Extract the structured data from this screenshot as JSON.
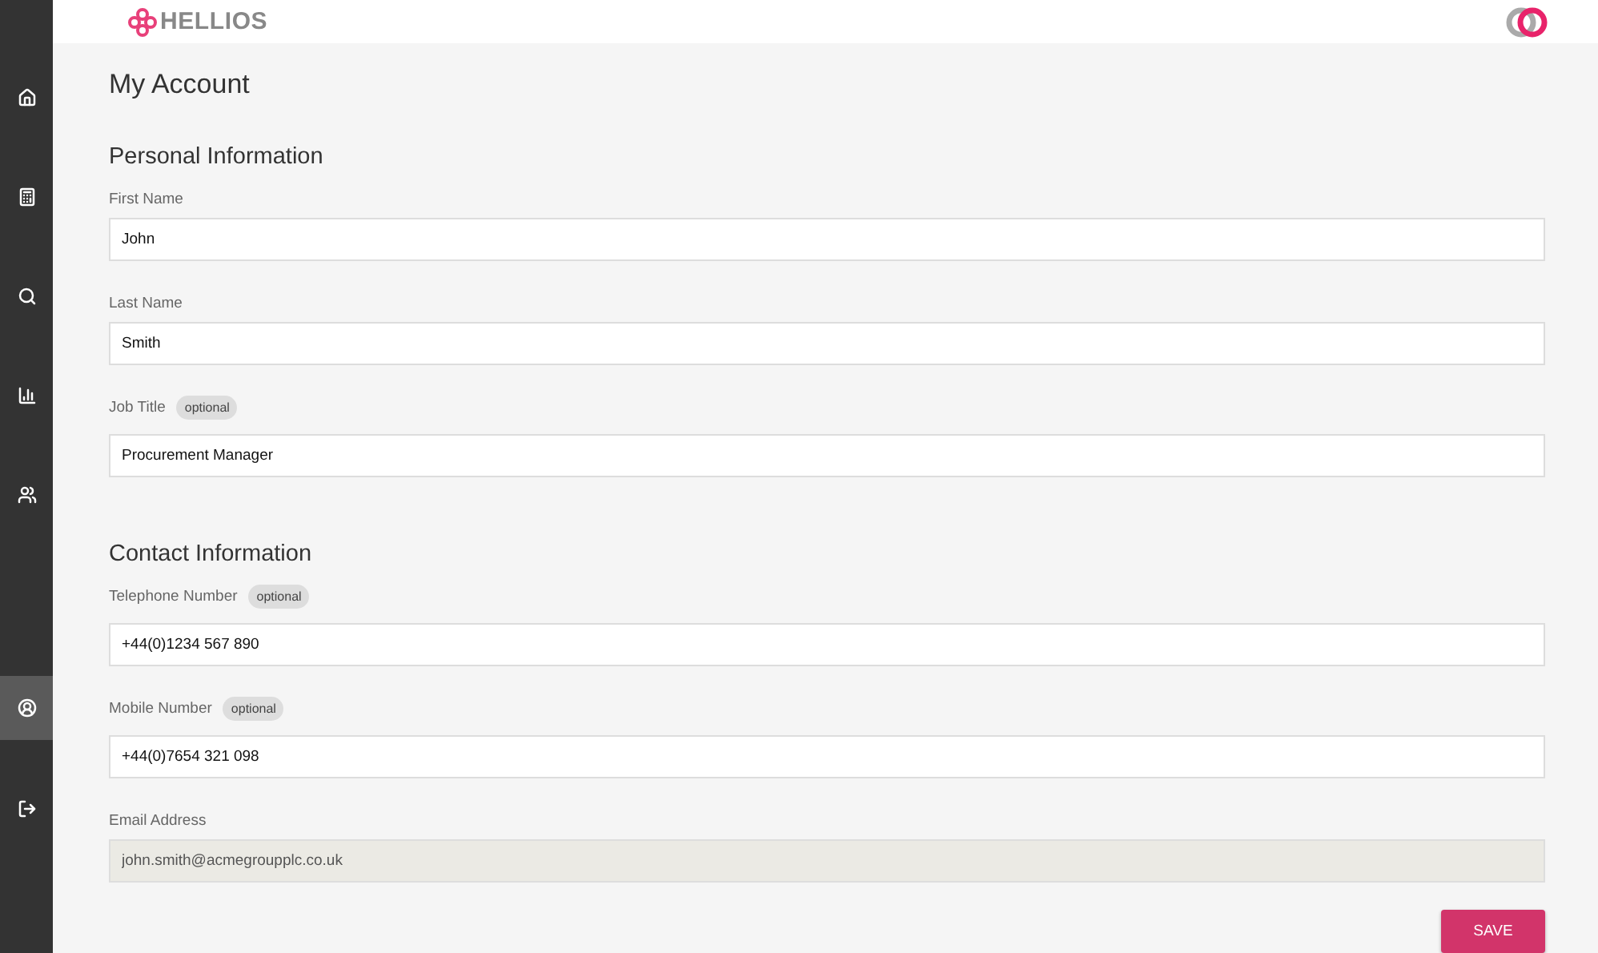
{
  "header": {
    "logo_text": "HELLIOS"
  },
  "sidebar": {
    "items": [
      {
        "kind": "home",
        "selected": false
      },
      {
        "kind": "calculator",
        "selected": false
      },
      {
        "kind": "search",
        "selected": false
      },
      {
        "kind": "chart",
        "selected": false
      },
      {
        "kind": "users",
        "selected": false
      }
    ],
    "bottom_items": [
      {
        "kind": "account",
        "selected": true
      },
      {
        "kind": "logout",
        "selected": false
      }
    ]
  },
  "page_title": "My Account",
  "sections": [
    {
      "title": "Personal Information",
      "fields": [
        {
          "label": "First Name",
          "value": "John",
          "disabled": false
        },
        {
          "label": "Last Name",
          "value": "Smith",
          "disabled": false
        },
        {
          "label": "Job Title",
          "badge": "optional",
          "value": "Procurement Manager",
          "disabled": false
        }
      ]
    },
    {
      "title": "Contact Information",
      "fields": [
        {
          "label": "Telephone Number",
          "badge": "optional",
          "value": "+44(0)1234 567 890",
          "disabled": false
        },
        {
          "label": "Mobile Number",
          "badge": "optional",
          "value": "+44(0)7654 321 098",
          "disabled": false
        },
        {
          "label": "Email Address",
          "value": "john.smith@acmegroupplc.co.uk",
          "disabled": true
        }
      ]
    }
  ],
  "save_button": "SAVE"
}
